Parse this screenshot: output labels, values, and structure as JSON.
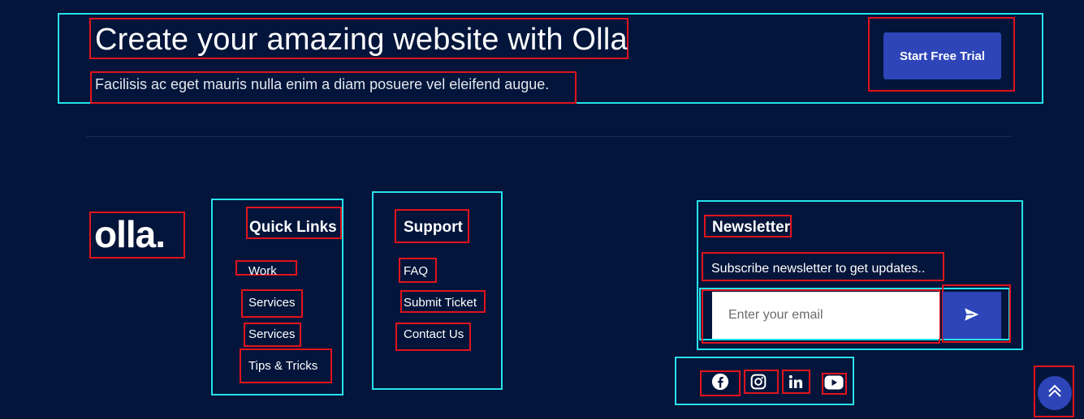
{
  "cta": {
    "title": "Create your amazing website with Olla",
    "subtitle": "Facilisis ac eget mauris nulla enim a diam posuere vel eleifend augue.",
    "button_label": "Start Free Trial"
  },
  "logo": {
    "text": "olla."
  },
  "quick_links": {
    "heading": "Quick Links",
    "items": [
      {
        "label": "Work"
      },
      {
        "label": "Services"
      },
      {
        "label": "Services"
      },
      {
        "label": "Tips & Tricks"
      }
    ]
  },
  "support": {
    "heading": "Support",
    "items": [
      {
        "label": "FAQ"
      },
      {
        "label": "Submit Ticket"
      },
      {
        "label": "Contact Us"
      }
    ]
  },
  "newsletter": {
    "heading": "Newsletter",
    "text": "Subscribe newsletter to get updates..",
    "email_placeholder": "Enter your email",
    "email_value": ""
  },
  "social": [
    {
      "icon": "facebook-icon"
    },
    {
      "icon": "instagram-icon"
    },
    {
      "icon": "linkedin-icon"
    },
    {
      "icon": "youtube-icon"
    }
  ],
  "colors": {
    "background": "#03153a",
    "accent": "#2d45b8",
    "text": "#ffffff"
  }
}
